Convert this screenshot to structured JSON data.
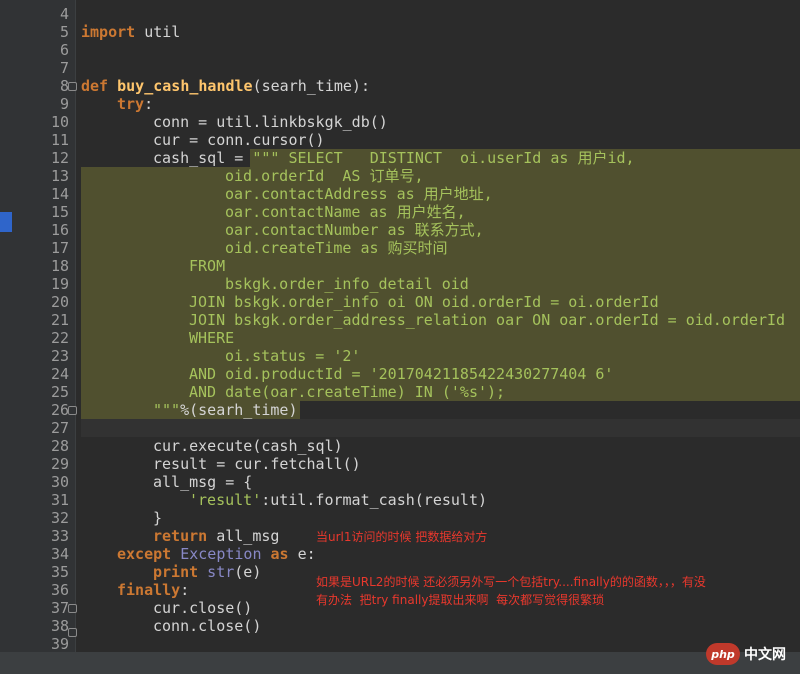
{
  "line_numbers": [
    "4",
    "5",
    "6",
    "7",
    "8",
    "9",
    "10",
    "11",
    "12",
    "13",
    "14",
    "15",
    "16",
    "17",
    "18",
    "19",
    "20",
    "21",
    "22",
    "23",
    "24",
    "25",
    "26",
    "27",
    "28",
    "29",
    "30",
    "31",
    "32",
    "33",
    "34",
    "35",
    "36",
    "37",
    "38",
    "39"
  ],
  "code": {
    "l5_kw": "import",
    "l5_rest": " util",
    "l8_kw": "def",
    "l8_fn": "buy_cash_handle",
    "l8_rest": "(searh_time):",
    "l9_kw": "try",
    "l9_rest": ":",
    "l10": "conn = util.linkbskgk_db()",
    "l11": "cur = conn.cursor()",
    "l12_a": "cash_sql = ",
    "l12_b": "\"\"\" SELECT   DISTINCT  oi.userId as 用户id,",
    "l13": "oid.orderId  AS 订单号,",
    "l14": "oar.contactAddress as 用户地址,",
    "l15": "oar.contactName as 用户姓名,",
    "l16": "oar.contactNumber as 联系方式,",
    "l17": "oid.createTime as 购买时间",
    "l18": "FROM",
    "l19": "bskgk.order_info_detail oid",
    "l20": "JOIN bskgk.order_info oi ON oid.orderId = oi.orderId",
    "l21": "JOIN bskgk.order_address_relation oar ON oar.orderId = oid.orderId",
    "l22": "WHERE",
    "l23": "oi.status = '2'",
    "l24": "AND oid.productId = '20170421185422430277404 6'",
    "l25": "AND date(oar.createTime) IN ('%s');",
    "l26_a": "\"\"\"",
    "l26_b": "%(searh_time)",
    "l28": "cur.execute(cash_sql)",
    "l29": "result = cur.fetchall()",
    "l30": "all_msg = {",
    "l31_str": "'result'",
    "l31_rest": ":util.format_cash(result)",
    "l32": "}",
    "l33_kw": "return",
    "l33_rest": " all_msg",
    "l34_kw": "except",
    "l34_bi": " Exception",
    "l34_kw2": " as",
    "l34_rest": " e:",
    "l35_kw": "print",
    "l35_bi": " str",
    "l35_rest": "(e)",
    "l36_kw": "finally",
    "l36_rest": ":",
    "l37": "cur.close()",
    "l38": "conn.close()"
  },
  "annotations": {
    "note1": "当url1访问的时候 把数据给对方",
    "note2_line1": "如果是URL2的时候 还必须另外写一个包括try....finally的的函数，，，有没",
    "note2_line2": "有办法  把try finally提取出来啊  每次都写觉得很繁琐"
  },
  "watermark": {
    "badge": "php",
    "text": "中文网"
  },
  "colors": {
    "background": "#2b2b2b",
    "keyword": "#cc7832",
    "function": "#ffc66d",
    "string": "#a5c25c",
    "highlight": "#50502f",
    "annotation": "#e9382d"
  }
}
